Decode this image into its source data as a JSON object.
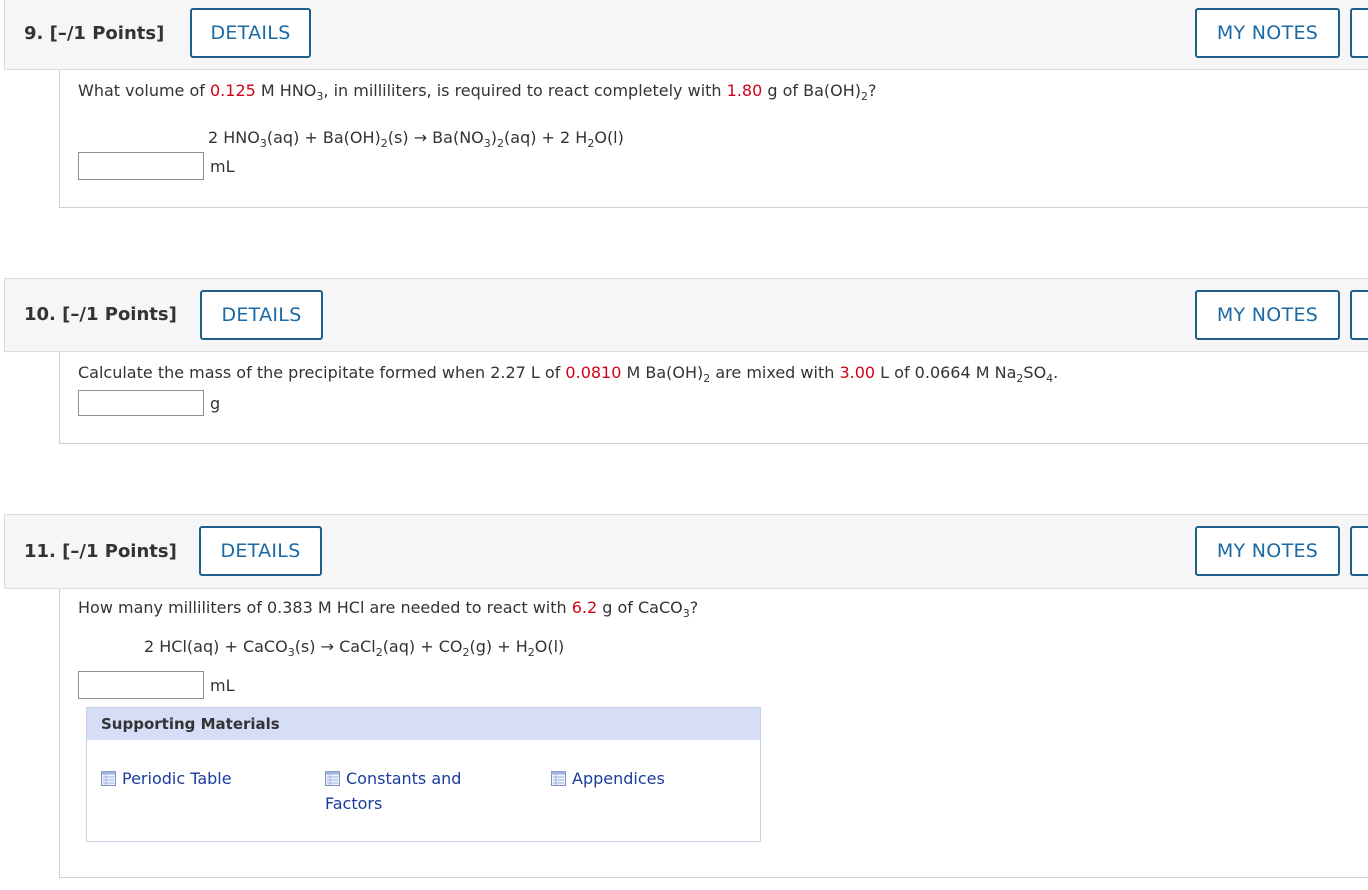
{
  "questions": [
    {
      "number_label": "9.  [–/1 Points]",
      "details_label": "DETAILS",
      "notes_label": "MY NOTES",
      "prompt": {
        "p1": "What volume of ",
        "v1": "0.125",
        "p2": " M HNO",
        "s1": "3",
        "p3": ", in milliliters, is required to react completely with ",
        "v2": "1.80",
        "p4": " g of Ba(OH)",
        "s2": "2",
        "p5": "?"
      },
      "equation": {
        "e1": "2 HNO",
        "s1": "3",
        "e2": "(aq)  +  Ba(OH)",
        "s2": "2",
        "e3": "(s)  →  Ba(NO",
        "s3": "3",
        "e4": ")",
        "s4": "2",
        "e5": "(aq)  +  2 H",
        "s5": "2",
        "e6": "O(l)"
      },
      "answer_value": "",
      "unit": "mL"
    },
    {
      "number_label": "10.  [–/1 Points]",
      "details_label": "DETAILS",
      "notes_label": "MY NOTES",
      "prompt": {
        "p1": "Calculate the mass of the precipitate formed when 2.27 L of ",
        "v1": "0.0810",
        "p2": " M Ba(OH)",
        "s1": "2",
        "p3": " are mixed with ",
        "v2": "3.00",
        "p4": " L of 0.0664 M Na",
        "s2": "2",
        "p5": "SO",
        "s3": "4",
        "p6": "."
      },
      "answer_value": "",
      "unit": "g"
    },
    {
      "number_label": "11.  [–/1 Points]",
      "details_label": "DETAILS",
      "notes_label": "MY NOTES",
      "prompt": {
        "p1": "How many milliliters of 0.383 M HCl are needed to react with ",
        "v1": "6.2",
        "p2": " g of CaCO",
        "s1": "3",
        "p3": "?"
      },
      "equation": {
        "e1": "2 HCl(aq)  +  CaCO",
        "s1": "3",
        "e2": "(s)  →  CaCl",
        "s2": "2",
        "e3": "(aq)  +  CO",
        "s3": "2",
        "e4": "(g)  +  H",
        "s4": "2",
        "e5": "O(l)"
      },
      "answer_value": "",
      "unit": "mL",
      "supporting": {
        "heading": "Supporting Materials",
        "links": [
          "Periodic Table",
          "Constants and",
          "Factors",
          "Appendices"
        ]
      }
    }
  ],
  "colors": {
    "accent": "#1b6aa5",
    "highlight": "#d0021b",
    "link": "#1a3c9e",
    "support_header": "#d6ddf6"
  }
}
